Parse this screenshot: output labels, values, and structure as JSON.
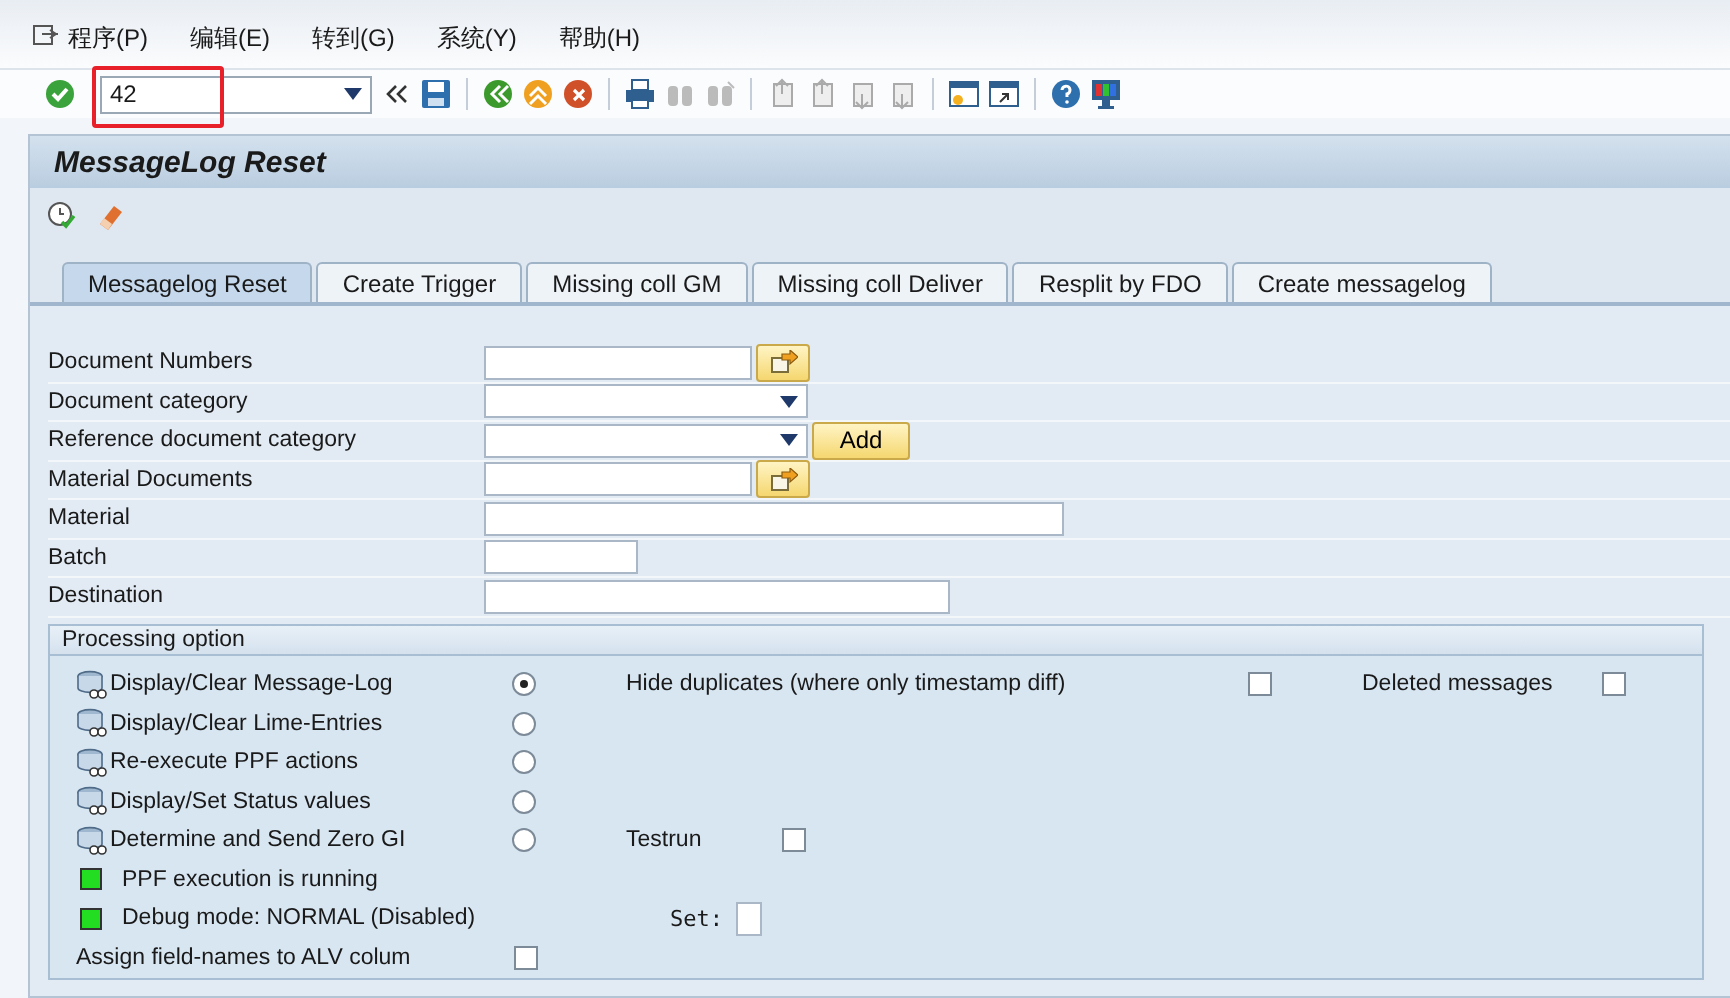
{
  "menu": [
    "程序(P)",
    "编辑(E)",
    "转到(G)",
    "系统(Y)",
    "帮助(H)"
  ],
  "command_field": {
    "value": "42",
    "highlighted": true
  },
  "title": "MessageLog Reset",
  "tabs": [
    {
      "label": "Messagelog Reset",
      "selected": true
    },
    {
      "label": "Create Trigger",
      "selected": false
    },
    {
      "label": "Missing coll GM",
      "selected": false
    },
    {
      "label": "Missing coll Deliver",
      "selected": false
    },
    {
      "label": "Resplit by FDO",
      "selected": false
    },
    {
      "label": "Create messagelog",
      "selected": false
    }
  ],
  "fields": [
    {
      "label": "Document Numbers",
      "kind": "multi"
    },
    {
      "label": "Document category",
      "kind": "dropdown"
    },
    {
      "label": "Reference document category",
      "kind": "dropdown",
      "button": "Add"
    },
    {
      "label": "Material Documents",
      "kind": "multi"
    },
    {
      "label": "Material",
      "kind": "long"
    },
    {
      "label": "Batch",
      "kind": "short"
    },
    {
      "label": "Destination",
      "kind": "medium"
    }
  ],
  "processing_option": {
    "title": "Processing option",
    "rows": [
      {
        "kind": "action",
        "label": "Display/Clear Message-Log",
        "selected": true,
        "extras": [
          {
            "kind": "checkbox",
            "label": "Hide duplicates (where only timestamp diff)",
            "checked": false
          },
          {
            "kind": "checkbox",
            "label": "Deleted messages",
            "checked": false
          }
        ]
      },
      {
        "kind": "action",
        "label": "Display/Clear Lime-Entries",
        "selected": false
      },
      {
        "kind": "action",
        "label": "Re-execute PPF actions",
        "selected": false
      },
      {
        "kind": "action",
        "label": "Display/Set Status values",
        "selected": false
      },
      {
        "kind": "action",
        "label": "Determine and Send Zero GI",
        "selected": false,
        "extras": [
          {
            "kind": "checkbox",
            "label": "Testrun",
            "checked": false
          }
        ]
      },
      {
        "kind": "status",
        "label": "PPF execution is running",
        "color": "#22dd22"
      },
      {
        "kind": "status",
        "label": "Debug mode: NORMAL (Disabled)",
        "color": "#22dd22",
        "extras": [
          {
            "kind": "field",
            "label": "Set:"
          }
        ]
      },
      {
        "kind": "check",
        "label": "Assign field-names to ALV colum",
        "checked": false
      }
    ]
  }
}
